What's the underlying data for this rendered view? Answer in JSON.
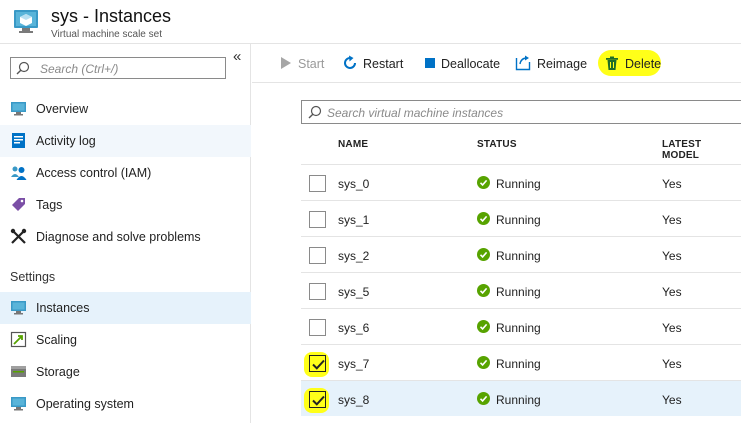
{
  "header": {
    "title": "sys - Instances",
    "subtitle": "Virtual machine scale set",
    "icon": "vmss-icon"
  },
  "sidebar": {
    "search_placeholder": "Search (Ctrl+/)",
    "collapse_glyph": "«",
    "items": [
      {
        "label": "Overview",
        "icon": "monitor-icon"
      },
      {
        "label": "Activity log",
        "icon": "log-icon"
      },
      {
        "label": "Access control (IAM)",
        "icon": "people-icon"
      },
      {
        "label": "Tags",
        "icon": "tag-icon"
      },
      {
        "label": "Diagnose and solve problems",
        "icon": "wrench-icon"
      }
    ],
    "section_settings": "Settings",
    "settings_items": [
      {
        "label": "Instances",
        "icon": "monitor-icon",
        "active": true
      },
      {
        "label": "Scaling",
        "icon": "scaling-icon"
      },
      {
        "label": "Storage",
        "icon": "storage-icon"
      },
      {
        "label": "Operating system",
        "icon": "monitor-icon"
      }
    ]
  },
  "toolbar": {
    "start_label": "Start",
    "restart_label": "Restart",
    "deallocate_label": "Deallocate",
    "reimage_label": "Reimage",
    "delete_label": "Delete"
  },
  "main": {
    "search_placeholder": "Search virtual machine instances",
    "columns": {
      "name": "NAME",
      "status": "STATUS",
      "latest": "LATEST MODEL"
    },
    "rows": [
      {
        "name": "sys_0",
        "status": "Running",
        "latest": "Yes",
        "checked": false
      },
      {
        "name": "sys_1",
        "status": "Running",
        "latest": "Yes",
        "checked": false
      },
      {
        "name": "sys_2",
        "status": "Running",
        "latest": "Yes",
        "checked": false
      },
      {
        "name": "sys_5",
        "status": "Running",
        "latest": "Yes",
        "checked": false
      },
      {
        "name": "sys_6",
        "status": "Running",
        "latest": "Yes",
        "checked": false
      },
      {
        "name": "sys_7",
        "status": "Running",
        "latest": "Yes",
        "checked": true
      },
      {
        "name": "sys_8",
        "status": "Running",
        "latest": "Yes",
        "checked": true
      }
    ]
  },
  "colors": {
    "accent": "#0072c6",
    "running": "#57a300",
    "highlight": "#ffff19",
    "selected_row": "#e6f2fb"
  }
}
